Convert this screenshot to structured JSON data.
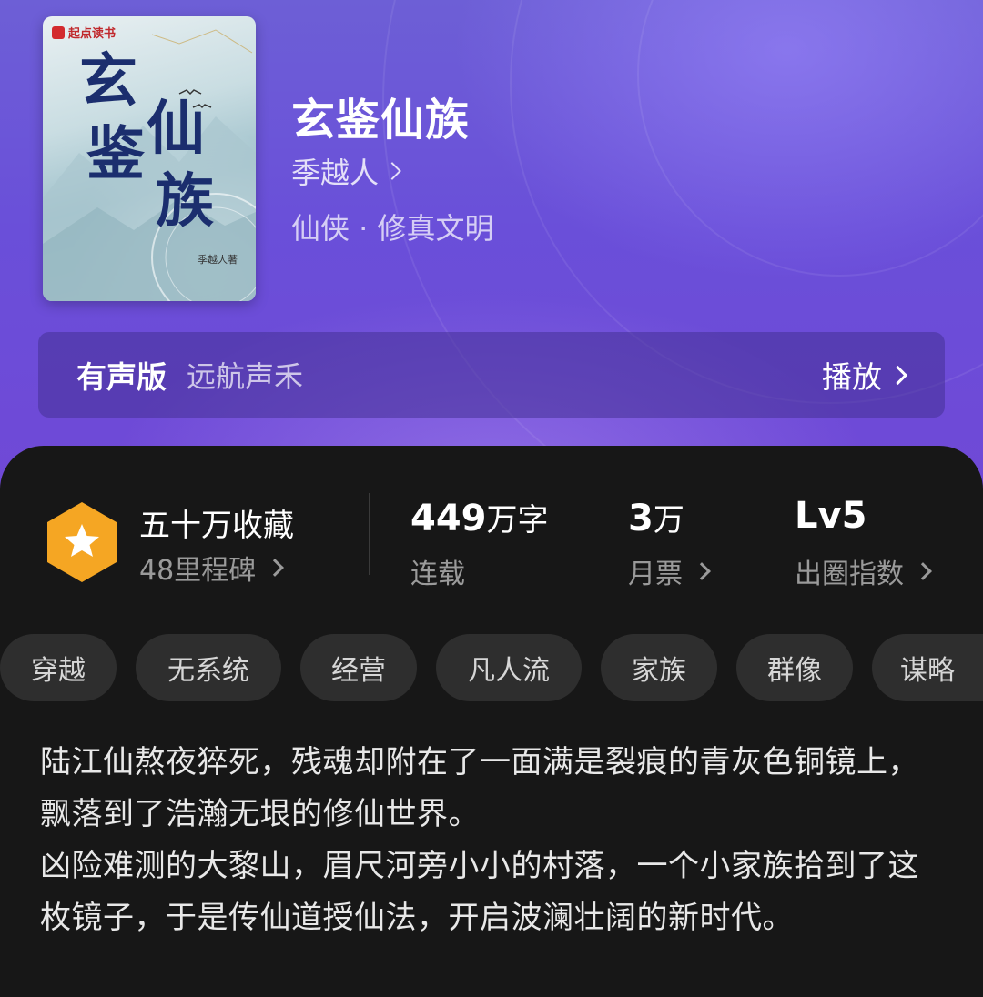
{
  "book": {
    "title": "玄鉴仙族",
    "author": "季越人",
    "genre": "仙侠 · 修真文明",
    "cover": {
      "brand": "起点读书",
      "title_chars": [
        "玄",
        "鉴",
        "仙",
        "族"
      ],
      "author": "季越人著"
    }
  },
  "audio": {
    "label": "有声版",
    "narrator": "远航声禾",
    "play_label": "播放"
  },
  "stats": {
    "collection_title": "五十万收藏",
    "milestones_label": "48里程碑",
    "word_count_number": "449",
    "word_count_unit": "万字",
    "status": "连载",
    "monthly_tickets_number": "3",
    "monthly_tickets_unit": "万",
    "monthly_tickets_label": "月票",
    "level": "Lv5",
    "level_label": "出圈指数"
  },
  "tags": [
    "穿越",
    "无系统",
    "经营",
    "凡人流",
    "家族",
    "群像",
    "谋略"
  ],
  "description": {
    "paragraph1": "陆江仙熬夜猝死，残魂却附在了一面满是裂痕的青灰色铜镜上，飘落到了浩瀚无垠的修仙世界。",
    "paragraph2": "凶险难测的大黎山，眉尺河旁小小的村落，一个小家族拾到了这枚镜子，于是传仙道授仙法，开启波澜壮阔的新时代。"
  },
  "colors": {
    "hero_purple": "#6a4fd9",
    "badge_orange": "#f5a623",
    "card_bg": "#171717",
    "tag_bg": "#2e2e2e"
  },
  "icons": {
    "badge": "star-hexagon-icon",
    "chevron": "chevron-right-icon"
  }
}
